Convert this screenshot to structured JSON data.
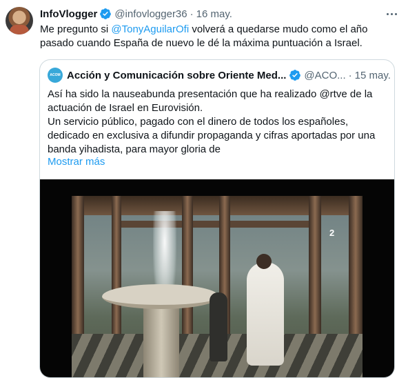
{
  "tweet": {
    "author_name": "InfoVlogger",
    "handle": "@infovlogger36",
    "separator": "·",
    "date": "16 may.",
    "text_part1": "Me pregunto si ",
    "mention": "@TonyAguilarOfi",
    "text_part2": " volverá a quedarse mudo como el año pasado cuando España de nuevo le dé la máxima puntuación a Israel."
  },
  "quoted": {
    "author_name": "Acción y Comunicación sobre Oriente Med...",
    "handle": "@ACO...",
    "separator": "·",
    "date": "15 may.",
    "text": "Así ha sido la nauseabunda presentación que ha realizado @rtve de la actuación de Israel en Eurovisión.\nUn servicio público, pagado con el dinero de todos los españoles, dedicado en exclusiva a difundir propaganda y cifras aportadas por una banda yihadista, para mayor gloria de",
    "show_more": "Mostrar más",
    "avatar_text": "ACOM"
  },
  "media": {
    "channel_logo": "2"
  },
  "icons": {
    "verified": "verified-badge-icon",
    "more": "more-options-icon"
  },
  "colors": {
    "link": "#1d9bf0",
    "text": "#0f1419",
    "muted": "#536471",
    "border": "#cfd9de"
  }
}
